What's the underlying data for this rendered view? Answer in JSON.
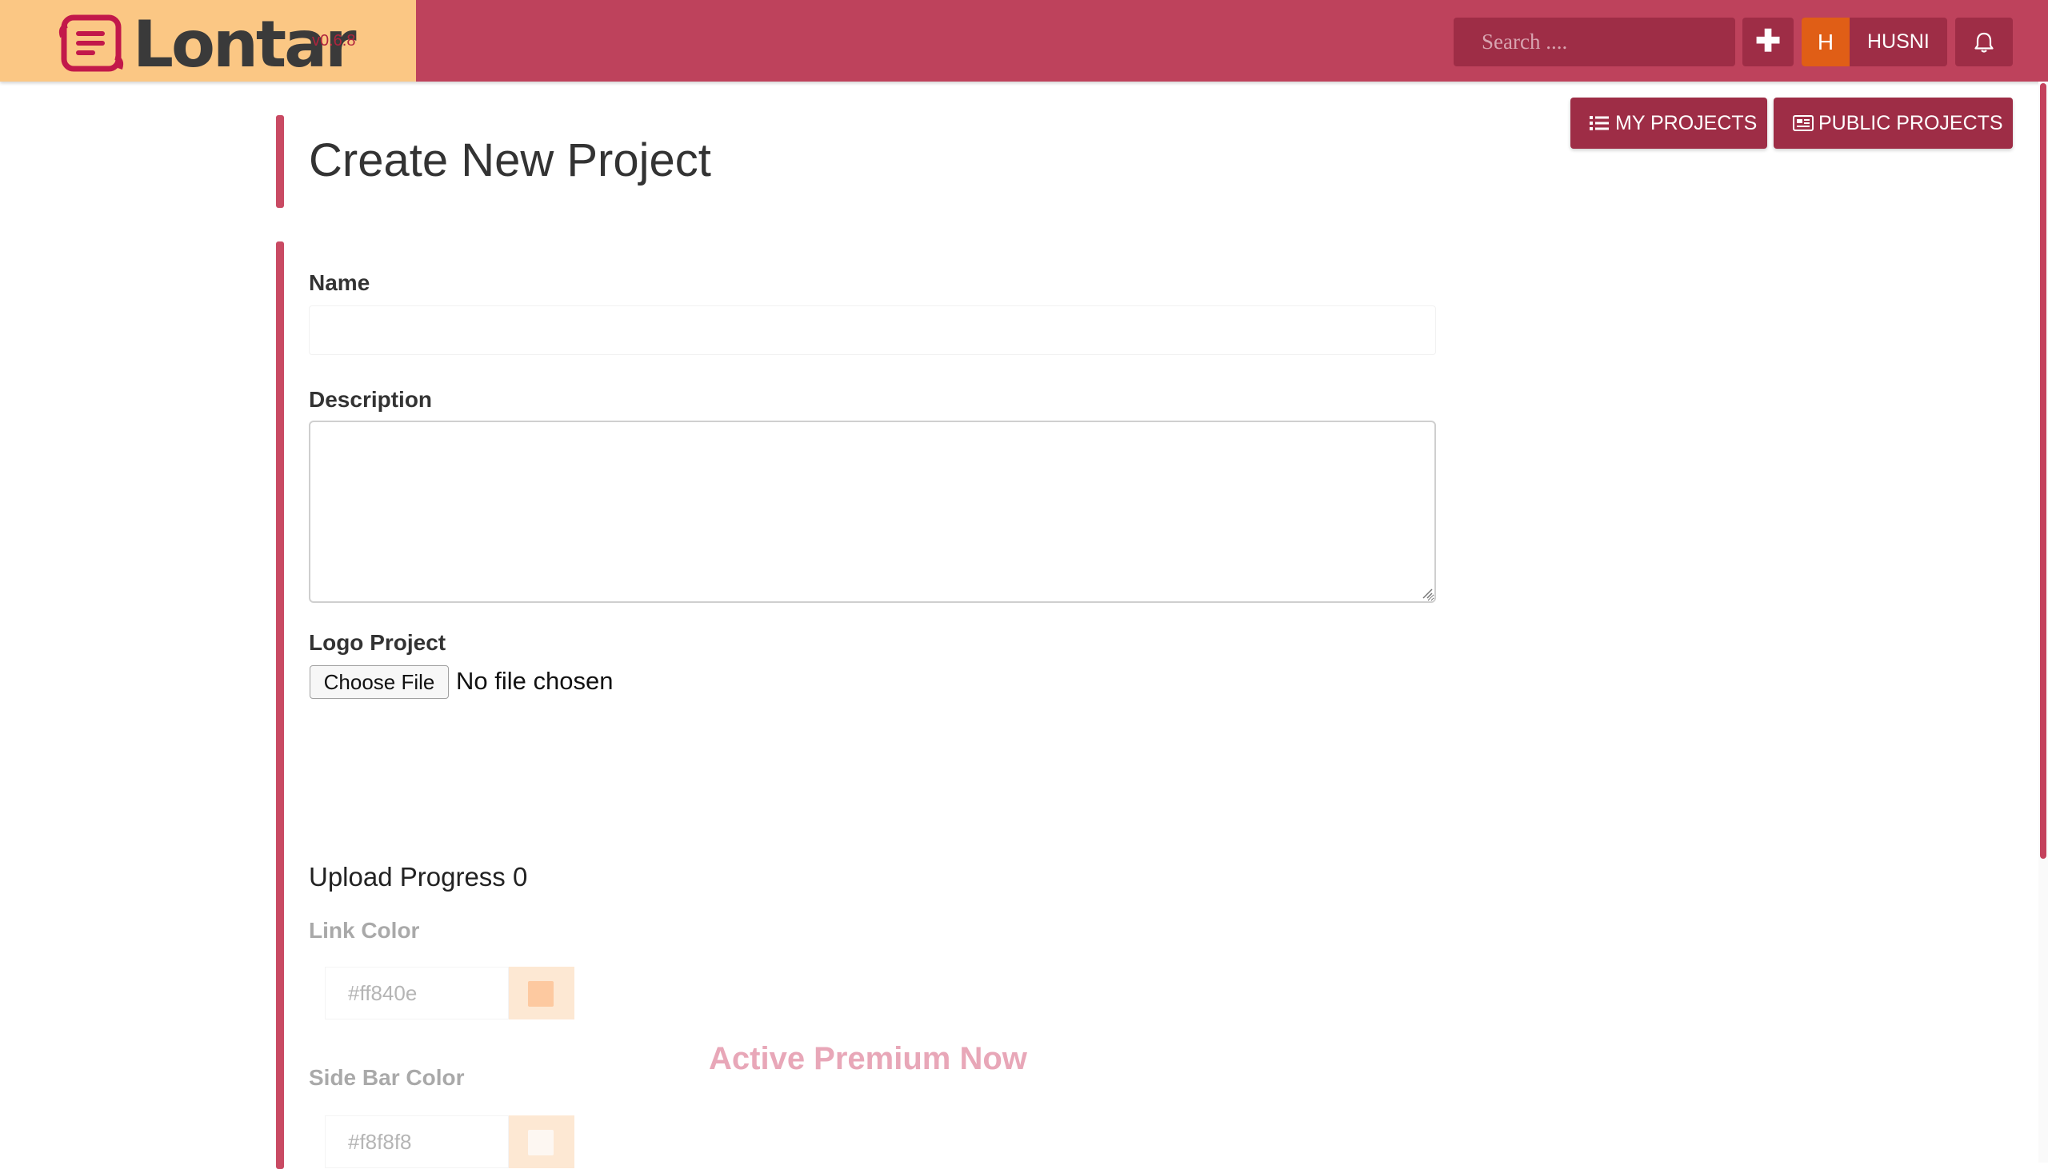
{
  "app": {
    "name": "Lontar",
    "version": "v0.6.8",
    "brand_color": "#be425c",
    "brand_bg": "#fbc784"
  },
  "topbar": {
    "search_placeholder": "Search ....",
    "add_icon": "plus-icon",
    "user_initial": "H",
    "user_name": "HUSNI",
    "notification_icon": "bell-icon"
  },
  "header_buttons": {
    "my_projects": "MY PROJECTS",
    "public_projects": "PUBLIC PROJECTS"
  },
  "page": {
    "title": "Create New Project"
  },
  "form": {
    "name_label": "Name",
    "name_value": "",
    "description_label": "Description",
    "description_value": "",
    "logo_label": "Logo Project",
    "choose_file_label": "Choose File",
    "no_file_text": "No file chosen",
    "upload_progress_text": "Upload Progress 0",
    "link_color_label": "Link Color",
    "link_color_value": "#ff840e",
    "sidebar_color_label": "Side Bar Color",
    "sidebar_color_value": "#f8f8f8",
    "premium_text": "Active Premium Now"
  }
}
